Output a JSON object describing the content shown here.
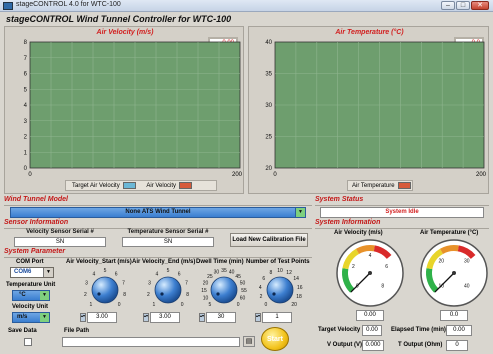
{
  "window": {
    "title": "stageCONTROL 4.0 for WTC-100"
  },
  "app_title": "stageCONTROL Wind Tunnel Controller for WTC-100",
  "velocity_chart": {
    "title": "Air Velocity (m/s)",
    "readout": "0.00",
    "y_ticks": [
      "8",
      "7",
      "6",
      "5",
      "4",
      "3",
      "2",
      "1",
      "0"
    ],
    "x_ticks": [
      "0",
      "200"
    ],
    "legend": [
      "Target Air Velocity",
      "Air Velocity"
    ]
  },
  "temperature_chart": {
    "title": "Air Temperature (°C)",
    "readout": "0.0",
    "y_ticks": [
      "40",
      "35",
      "30",
      "25",
      "20"
    ],
    "x_ticks": [
      "0",
      "200"
    ],
    "legend": [
      "Air Temperature"
    ]
  },
  "chart_data": [
    {
      "type": "line",
      "title": "Air Velocity (m/s)",
      "xlabel": "",
      "ylabel": "",
      "xlim": [
        0,
        200
      ],
      "ylim": [
        0,
        8
      ],
      "grid": true,
      "legend_position": "bottom",
      "series": [
        {
          "name": "Target Air Velocity",
          "values": []
        },
        {
          "name": "Air Velocity",
          "values": []
        }
      ]
    },
    {
      "type": "line",
      "title": "Air Temperature (°C)",
      "xlabel": "",
      "ylabel": "",
      "xlim": [
        0,
        200
      ],
      "ylim": [
        20,
        40
      ],
      "grid": true,
      "legend_position": "bottom",
      "series": [
        {
          "name": "Air Temperature",
          "values": []
        }
      ]
    }
  ],
  "model": {
    "heading": "Wind Tunnel Model",
    "value": "None ATS Wind Tunnel"
  },
  "sensor": {
    "heading": "Sensor Information",
    "velocity_label": "Velocity Sensor Serial #",
    "velocity_value": "SN",
    "temp_label": "Temperature Sensor Serial #",
    "temp_value": "SN",
    "calibration_button": "Load New Calibration File"
  },
  "params": {
    "heading": "System Parameter",
    "com_label": "COM Port",
    "com_value": "COM6",
    "temp_unit_label": "Temperature Unit",
    "temp_unit_value": "°C",
    "vel_unit_label": "Velocity Unit",
    "vel_unit_value": "m/s",
    "save_label": "Save Data",
    "file_label": "File Path",
    "file_value": "",
    "start_button": "Start",
    "knobs": [
      {
        "label": "Air Velocity_Start (m/s)",
        "value": "3.00",
        "scale": [
          "1",
          "2",
          "3",
          "4",
          "5",
          "6",
          "7",
          "8",
          "0"
        ]
      },
      {
        "label": "Air Velocity_End (m/s)",
        "value": "3.00",
        "scale": [
          "1",
          "2",
          "3",
          "4",
          "5",
          "6",
          "7",
          "8",
          "0"
        ]
      },
      {
        "label": "Dwell Time (min)",
        "value": "30",
        "scale": [
          "5",
          "10",
          "15",
          "20",
          "25",
          "30",
          "35",
          "40",
          "45",
          "50",
          "55",
          "60",
          "0"
        ]
      },
      {
        "label": "Number of Test Points",
        "value": "1",
        "scale": [
          "0",
          "2",
          "4",
          "6",
          "8",
          "10",
          "12",
          "14",
          "16",
          "18",
          "20"
        ]
      }
    ]
  },
  "status": {
    "heading": "System Status",
    "value": "System Idle"
  },
  "info": {
    "heading": "System Information",
    "gauge_velocity_label": "Air Velocity (m/s)",
    "gauge_velocity_value": "0.00",
    "gauge_velocity_scale": [
      "0",
      "2",
      "4",
      "6",
      "8"
    ],
    "gauge_temp_label": "Air Temperature (°C)",
    "gauge_temp_value": "0.0",
    "gauge_temp_scale": [
      "10",
      "20",
      "30",
      "40"
    ],
    "target_velocity_label": "Target Velocity",
    "target_velocity_value": "0.00",
    "elapsed_label": "Elapsed Time (min)",
    "elapsed_value": "0.00",
    "v_output_label": "V  Output (V)",
    "v_output_value": "0.000",
    "t_output_label": "T Output (Ohm)",
    "t_output_value": "0"
  },
  "colors": {
    "plot_bg": "#6e9e6e",
    "grid": "#8fb58f",
    "accent_red": "#d21e1e",
    "section_blue": "#3a7ed0"
  }
}
